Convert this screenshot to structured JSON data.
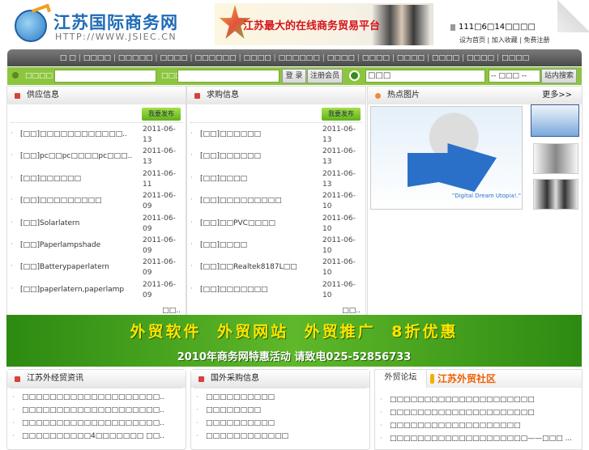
{
  "header": {
    "site_name": "江苏国际商务网",
    "site_url": "HTTP://WWW.JSIEC.CN",
    "slogan": "江苏最大的在线商务贸易平台",
    "date": "111□6□14□□□□",
    "links": "设为首页 | 加入收藏 | 免费注册"
  },
  "nav": [
    "□ □",
    "□□□□",
    "□□□□□",
    "□□□□",
    "□□□□□□",
    "□□□□",
    "□□□□□□",
    "□□□□",
    "□□□□",
    "□□□□",
    "□□□□",
    "□□□□",
    "□□□□"
  ],
  "search": {
    "user_label": "□□□□",
    "pass_label": "□□□",
    "login": "登 录",
    "register": "注册会员",
    "keyword": "□□□",
    "category": "-- □□□ --",
    "submit": "站内搜索"
  },
  "supply": {
    "title": "供应信息",
    "post": "我要发布",
    "more": "□□..",
    "items": [
      {
        "t": "[□□]□□□□□□□□□□□□..",
        "d": "2011-06-13"
      },
      {
        "t": "[□□]pc□□pc□□□□pc□□□..",
        "d": "2011-06-13"
      },
      {
        "t": "[□□]□□□□□□",
        "d": "2011-06-11"
      },
      {
        "t": "[□□]□□□□□□□□□",
        "d": "2011-06-09"
      },
      {
        "t": "[□□]Solarlatern",
        "d": "2011-06-09"
      },
      {
        "t": "[□□]Paperlampshade",
        "d": "2011-06-09"
      },
      {
        "t": "[□□]Batterypaperlatern",
        "d": "2011-06-09"
      },
      {
        "t": "[□□]paperlatern,paperlamp",
        "d": "2011-06-09"
      }
    ]
  },
  "demand": {
    "title": "求购信息",
    "post": "我要发布",
    "more": "□□..",
    "items": [
      {
        "t": "[□□]□□□□□□",
        "d": "2011-06-13"
      },
      {
        "t": "[□□]□□□□□□",
        "d": "2011-06-13"
      },
      {
        "t": "[□□]□□□□",
        "d": "2011-06-13"
      },
      {
        "t": "[□□]□□□□□□□□□",
        "d": "2011-06-10"
      },
      {
        "t": "[□□]□□PVC□□□□",
        "d": "2011-06-10"
      },
      {
        "t": "[□□]□□□□",
        "d": "2011-06-10"
      },
      {
        "t": "[□□]□□Realtek8187L□□",
        "d": "2011-06-10"
      },
      {
        "t": "[□□]□□□□□□□",
        "d": "2011-06-10"
      }
    ]
  },
  "hot": {
    "title": "热点图片",
    "more": "更多>>",
    "caption": "\"Digital Dream Utopia!.\""
  },
  "promo": {
    "line1": "外贸软件 外贸网站 外贸推广 8折优惠",
    "line2": "2010年商务网特惠活动  请致电025-52856733"
  },
  "news": {
    "title": "江苏外经贸资讯",
    "items": [
      "□□□□□□□□□□□□□□□□□□□□..",
      "□□□□□□□□□□□□□□□□□□□□..",
      "□□□□□□□□□□□□□□□□□□□□..",
      "□□□□□□□□□□4□□□□□□□ □□.."
    ]
  },
  "foreign": {
    "title": "国外采购信息",
    "items": [
      "□□□□□□□□□□",
      "□□□□□□□□",
      "□□□□□□□□□□",
      "□□□□□□□□□□□□"
    ]
  },
  "forum": {
    "tab": "外贸论坛",
    "brand": "江苏外贸社区",
    "items": [
      "□□□□□□□□□□□□□□□□□□□□□",
      "□□□□□□□□□□□□□□□□□□□□□",
      "□□□□□□□□□□□□□□□□□□□",
      "□□□□□□□□□□□□□□□□□□□□——□□□ ..."
    ]
  }
}
